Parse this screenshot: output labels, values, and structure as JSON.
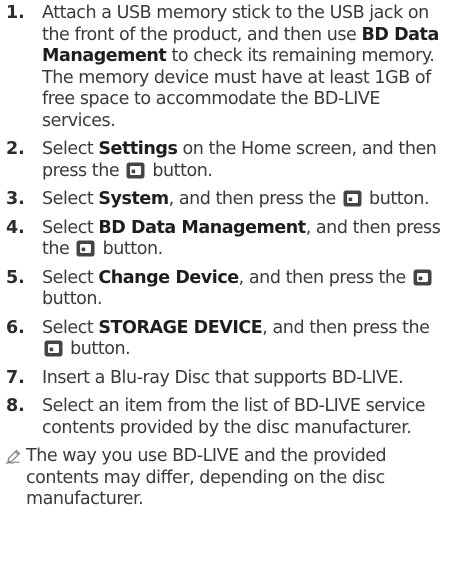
{
  "steps": [
    {
      "number": "1.",
      "parts": [
        {
          "t": "Attach a USB memory stick to the USB jack on the front of the product, and then use "
        },
        {
          "b": "BD Data Management"
        },
        {
          "t": " to check its remaining memory. The memory device must have at least 1GB of free space to accommodate the BD-LIVE services."
        }
      ]
    },
    {
      "number": "2.",
      "parts": [
        {
          "t": "Select "
        },
        {
          "b": "Settings"
        },
        {
          "t": " on the Home screen, and then press the "
        },
        {
          "icon": "enter-button-icon"
        },
        {
          "t": " button."
        }
      ]
    },
    {
      "number": "3.",
      "parts": [
        {
          "t": "Select "
        },
        {
          "b": "System"
        },
        {
          "t": ", and then press the "
        },
        {
          "icon": "enter-button-icon"
        },
        {
          "t": " button."
        }
      ]
    },
    {
      "number": "4.",
      "parts": [
        {
          "t": "Select "
        },
        {
          "b": "BD Data Management"
        },
        {
          "t": ", and then press the "
        },
        {
          "icon": "enter-button-icon"
        },
        {
          "t": " button."
        }
      ]
    },
    {
      "number": "5.",
      "parts": [
        {
          "t": "Select "
        },
        {
          "b": "Change Device"
        },
        {
          "t": ", and then press the "
        },
        {
          "icon": "enter-button-icon"
        },
        {
          "t": " button."
        }
      ]
    },
    {
      "number": "6.",
      "parts": [
        {
          "t": "Select "
        },
        {
          "b": "STORAGE DEVICE"
        },
        {
          "t": ", and then press the "
        },
        {
          "icon": "enter-button-icon"
        },
        {
          "t": " button."
        }
      ]
    },
    {
      "number": "7.",
      "parts": [
        {
          "t": "Insert a Blu-ray Disc that supports BD-LIVE."
        }
      ]
    },
    {
      "number": "8.",
      "parts": [
        {
          "t": "Select an item from the list of BD-LIVE service contents provided by the disc manufacturer."
        }
      ]
    }
  ],
  "note": {
    "icon": "note-pencil-icon",
    "text": "The way you use BD-LIVE and the provided contents may differ, depending on the disc manufacturer."
  },
  "colors": {
    "text": "#3a3a3a",
    "number": "#2c2c2c",
    "icon": "#444444"
  }
}
